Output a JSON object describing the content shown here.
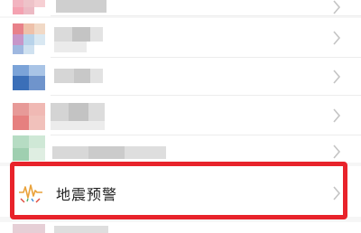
{
  "list": {
    "items": [
      {
        "label": ""
      },
      {
        "label": ""
      },
      {
        "label": ""
      },
      {
        "label": ""
      },
      {
        "label": ""
      },
      {
        "label": "地震预警",
        "icon": "earthquake-warning-icon",
        "highlighted": true
      },
      {
        "label": ""
      }
    ]
  },
  "colors": {
    "highlight": "#e8232b",
    "chevron": "#c4c4c4",
    "background": "#f6f6f6"
  }
}
